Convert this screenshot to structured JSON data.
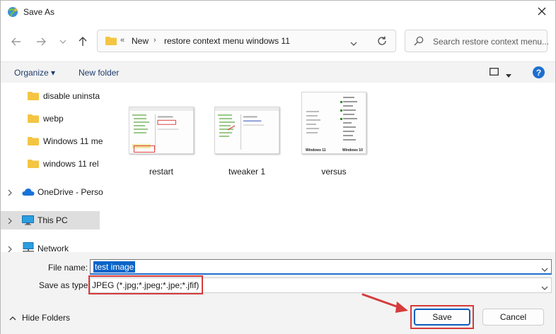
{
  "window": {
    "title": "Save As"
  },
  "address": {
    "prefix": "«",
    "crumbs": [
      "New",
      "restore context menu windows 11"
    ],
    "sep": "›"
  },
  "search": {
    "placeholder": "Search restore context menu..."
  },
  "toolbar": {
    "organize": "Organize ▾",
    "new_folder": "New folder",
    "help": "?"
  },
  "nav": {
    "items": [
      {
        "label": "disable uninsta",
        "icon": "folder-icon"
      },
      {
        "label": "webp",
        "icon": "folder-icon"
      },
      {
        "label": "Windows 11 me",
        "icon": "folder-icon"
      },
      {
        "label": "windows 11 rel",
        "icon": "folder-icon"
      },
      {
        "label": "OneDrive - Perso",
        "icon": "cloud-icon"
      },
      {
        "label": "This PC",
        "icon": "computer-icon",
        "selected": true
      },
      {
        "label": "Network",
        "icon": "network-icon"
      }
    ]
  },
  "files": [
    {
      "name": "restart"
    },
    {
      "name": "tweaker 1"
    },
    {
      "name": "versus",
      "labels": [
        "Windows 11",
        "Windows 10"
      ]
    }
  ],
  "form": {
    "file_name_label": "File name:",
    "file_name_value": "test image",
    "save_type_label": "Save as type:",
    "save_type_value": "JPEG (*.jpg;*.jpeg;*.jpe;*.jfif)"
  },
  "footer": {
    "hide_folders": "Hide Folders",
    "save": "Save",
    "cancel": "Cancel"
  },
  "colors": {
    "accent": "#0a64c8",
    "highlight": "#d63b3b",
    "folder": "#f4c542"
  }
}
